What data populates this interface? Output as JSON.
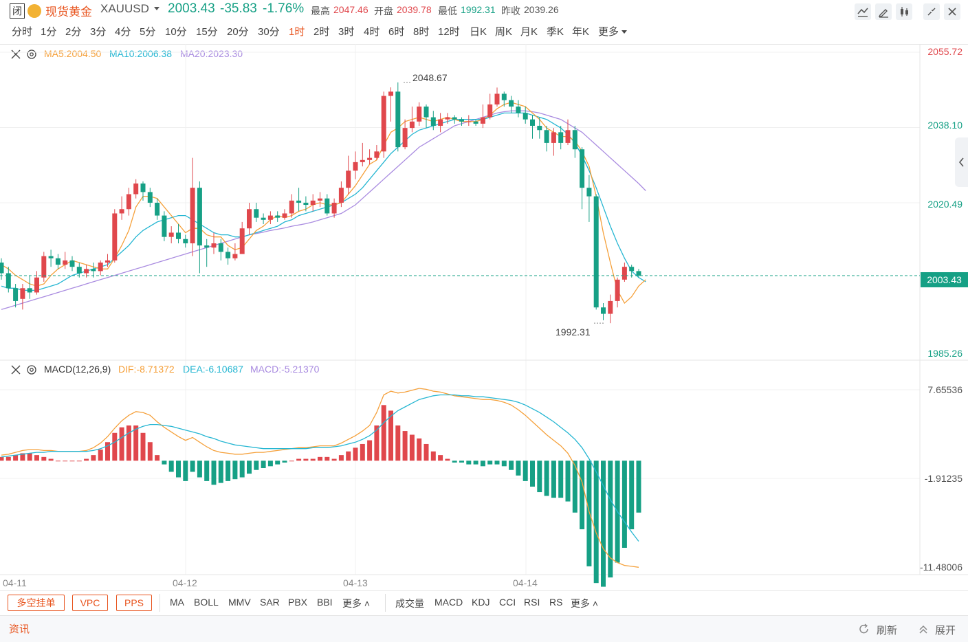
{
  "header": {
    "status_badge": "闭",
    "symbol_name": "现货黄金",
    "symbol_code": "XAUUSD",
    "price": "2003.43",
    "change": "-35.83",
    "change_pct": "-1.76%",
    "high_label": "最高",
    "high_value": "2047.46",
    "open_label": "开盘",
    "open_value": "2039.78",
    "low_label": "最低",
    "low_value": "1992.31",
    "prev_close_label": "昨收",
    "prev_close_value": "2039.26"
  },
  "periods": [
    "分时",
    "1分",
    "2分",
    "3分",
    "4分",
    "5分",
    "10分",
    "15分",
    "20分",
    "30分",
    "1时",
    "2时",
    "3时",
    "4时",
    "6时",
    "8时",
    "12时",
    "日K",
    "周K",
    "月K",
    "季K",
    "年K",
    "更多"
  ],
  "active_period": "1时",
  "main_legend": {
    "ma5": "MA5:2004.50",
    "ma10": "MA10:2006.38",
    "ma20": "MA20:2023.30"
  },
  "macd_legend": {
    "name": "MACD(12,26,9)",
    "dif": "DIF:-8.71372",
    "dea": "DEA:-6.10687",
    "macd": "MACD:-5.21370"
  },
  "price_axis": [
    "2055.72",
    "2038.10",
    "2020.49",
    "2003.43",
    "1985.26"
  ],
  "macd_axis": [
    "7.65536",
    "-1.91235",
    "-11.48006"
  ],
  "x_axis": [
    "04-11",
    "04-12",
    "04-13",
    "04-14"
  ],
  "annotations": {
    "high": "2048.67",
    "low": "1992.31"
  },
  "current_price_tag": "2003.43",
  "indicator_buttons": [
    "多空挂单",
    "VPC",
    "PPS"
  ],
  "main_indicators": [
    "MA",
    "BOLL",
    "MMV",
    "SAR",
    "PBX",
    "BBI",
    "更多"
  ],
  "sub_indicators": [
    "成交量",
    "MACD",
    "KDJ",
    "CCI",
    "RSI",
    "RS",
    "更多"
  ],
  "footer": {
    "news": "资讯",
    "refresh": "刷新",
    "expand": "展开"
  },
  "colors": {
    "up": "#e0474c",
    "down": "#16a085",
    "ma5": "#f5a03a",
    "ma10": "#25b6d2",
    "ma20": "#a98be0",
    "accent": "#e8541e"
  },
  "chart_data": {
    "type": "candlestick",
    "y_range": [
      1985.26,
      2055.72
    ],
    "macd_range": [
      -11.48006,
      7.65536
    ],
    "candles": [
      [
        2006.5,
        2004.0,
        2007.5,
        2002.5
      ],
      [
        2004.0,
        2000.5,
        2005.5,
        1999.5
      ],
      [
        2000.5,
        1997.5,
        2001.5,
        1996.0
      ],
      [
        1998.0,
        2000.5,
        2001.5,
        1995.5
      ],
      [
        2000.5,
        1999.5,
        2003.5,
        1998.0
      ],
      [
        1999.5,
        2003.0,
        2004.5,
        1999.0
      ],
      [
        2003.0,
        2008.0,
        2009.0,
        2002.0
      ],
      [
        2008.0,
        2007.5,
        2009.5,
        2005.5
      ],
      [
        2007.5,
        2006.0,
        2008.5,
        2005.0
      ],
      [
        2006.0,
        2007.0,
        2009.0,
        2005.0
      ],
      [
        2007.0,
        2005.5,
        2008.0,
        2004.5
      ],
      [
        2005.5,
        2004.0,
        2006.5,
        2003.0
      ],
      [
        2004.0,
        2005.0,
        2006.0,
        2003.0
      ],
      [
        2005.0,
        2004.5,
        2006.5,
        2003.0
      ],
      [
        2004.5,
        2006.5,
        2007.0,
        2003.5
      ],
      [
        2006.5,
        2007.0,
        2008.5,
        2005.5
      ],
      [
        2007.0,
        2018.0,
        2019.0,
        2006.5
      ],
      [
        2018.0,
        2019.0,
        2022.0,
        2016.5
      ],
      [
        2019.0,
        2022.5,
        2024.0,
        2017.5
      ],
      [
        2022.5,
        2025.0,
        2026.0,
        2021.5
      ],
      [
        2025.0,
        2023.0,
        2025.5,
        2021.0
      ],
      [
        2023.0,
        2020.5,
        2024.0,
        2019.5
      ],
      [
        2020.5,
        2017.5,
        2021.5,
        2016.5
      ],
      [
        2017.5,
        2012.5,
        2018.5,
        2011.5
      ],
      [
        2012.5,
        2013.5,
        2015.0,
        2011.0
      ],
      [
        2013.5,
        2012.0,
        2015.5,
        2011.0
      ],
      [
        2012.0,
        2011.0,
        2013.0,
        2010.0
      ],
      [
        2011.0,
        2024.0,
        2031.0,
        2008.0
      ],
      [
        2024.0,
        2010.5,
        2025.5,
        2004.0
      ],
      [
        2010.5,
        2010.0,
        2012.0,
        2005.5
      ],
      [
        2010.0,
        2011.0,
        2013.5,
        2008.5
      ],
      [
        2011.0,
        2009.0,
        2012.0,
        2007.0
      ],
      [
        2009.0,
        2007.5,
        2010.0,
        2006.0
      ],
      [
        2007.5,
        2008.5,
        2011.0,
        2007.0
      ],
      [
        2008.5,
        2014.5,
        2016.0,
        2008.5
      ],
      [
        2014.5,
        2019.0,
        2020.5,
        2013.0
      ],
      [
        2019.0,
        2017.0,
        2020.5,
        2016.0
      ],
      [
        2017.0,
        2016.5,
        2018.0,
        2015.5
      ],
      [
        2016.5,
        2017.5,
        2018.5,
        2015.5
      ],
      [
        2017.5,
        2017.0,
        2018.5,
        2016.0
      ],
      [
        2017.0,
        2018.0,
        2019.0,
        2016.5
      ],
      [
        2018.0,
        2021.0,
        2022.5,
        2017.0
      ],
      [
        2021.0,
        2020.5,
        2024.0,
        2018.5
      ],
      [
        2020.5,
        2020.0,
        2022.0,
        2018.5
      ],
      [
        2020.0,
        2021.0,
        2022.5,
        2018.5
      ],
      [
        2021.0,
        2021.5,
        2023.0,
        2019.5
      ],
      [
        2021.5,
        2018.0,
        2022.5,
        2017.5
      ],
      [
        2018.0,
        2020.5,
        2021.5,
        2017.0
      ],
      [
        2020.5,
        2024.0,
        2025.5,
        2019.5
      ],
      [
        2024.0,
        2028.0,
        2031.5,
        2022.5
      ],
      [
        2028.0,
        2030.0,
        2032.5,
        2026.0
      ],
      [
        2030.0,
        2030.5,
        2034.5,
        2029.0
      ],
      [
        2030.5,
        2031.0,
        2033.0,
        2029.5
      ],
      [
        2031.0,
        2032.5,
        2034.0,
        2030.5
      ],
      [
        2032.5,
        2045.5,
        2046.5,
        2031.0
      ],
      [
        2045.5,
        2046.5,
        2047.5,
        2039.5
      ],
      [
        2046.5,
        2033.5,
        2048.67,
        2032.5
      ],
      [
        2033.5,
        2038.0,
        2040.0,
        2033.0
      ],
      [
        2038.0,
        2039.5,
        2043.0,
        2037.0
      ],
      [
        2039.5,
        2043.0,
        2044.0,
        2038.5
      ],
      [
        2043.0,
        2040.5,
        2043.5,
        2038.0
      ],
      [
        2040.5,
        2038.5,
        2042.0,
        2037.5
      ],
      [
        2038.5,
        2040.0,
        2041.5,
        2037.0
      ],
      [
        2040.0,
        2040.5,
        2041.5,
        2039.0
      ],
      [
        2040.5,
        2040.0,
        2041.0,
        2039.0
      ],
      [
        2040.0,
        2039.5,
        2040.5,
        2038.5
      ],
      [
        2039.5,
        2039.5,
        2041.0,
        2038.5
      ],
      [
        2039.5,
        2039.0,
        2040.0,
        2038.5
      ],
      [
        2039.0,
        2040.5,
        2043.5,
        2038.0
      ],
      [
        2040.5,
        2043.5,
        2046.0,
        2040.0
      ],
      [
        2043.5,
        2046.0,
        2047.46,
        2043.0
      ],
      [
        2046.0,
        2044.5,
        2046.5,
        2043.0
      ],
      [
        2044.5,
        2043.0,
        2045.5,
        2041.5
      ],
      [
        2043.0,
        2041.5,
        2044.5,
        2040.5
      ],
      [
        2041.5,
        2040.0,
        2043.0,
        2039.0
      ],
      [
        2040.0,
        2038.5,
        2041.0,
        2035.5
      ],
      [
        2038.5,
        2037.5,
        2040.5,
        2035.5
      ],
      [
        2037.5,
        2034.5,
        2038.5,
        2032.5
      ],
      [
        2034.5,
        2037.0,
        2038.0,
        2031.5
      ],
      [
        2037.0,
        2034.5,
        2038.5,
        2033.0
      ],
      [
        2034.5,
        2037.5,
        2040.0,
        2034.0
      ],
      [
        2037.5,
        2033.0,
        2038.5,
        2031.0
      ],
      [
        2033.0,
        2024.0,
        2033.5,
        2019.0
      ],
      [
        2024.0,
        2022.0,
        2027.0,
        2016.0
      ],
      [
        2022.0,
        1996.0,
        2022.5,
        1995.5
      ],
      [
        1996.0,
        1994.5,
        1997.0,
        1993.0
      ],
      [
        1994.5,
        1997.5,
        1999.0,
        1992.31
      ],
      [
        1997.5,
        2002.5,
        2003.0,
        1996.0
      ],
      [
        2002.5,
        2005.5,
        2006.5,
        2002.0
      ],
      [
        2005.5,
        2004.5,
        2006.0,
        2003.0
      ],
      [
        2004.5,
        2003.43,
        2005.0,
        2003.0
      ]
    ],
    "ma5": [
      2006.0,
      2005.0,
      2003.5,
      2002.5,
      2001.5,
      2001.0,
      2001.5,
      2003.5,
      2005.0,
      2006.0,
      2007.0,
      2006.5,
      2006.0,
      2005.5,
      2005.0,
      2005.0,
      2007.5,
      2010.5,
      2014.0,
      2019.5,
      2022.0,
      2022.0,
      2021.5,
      2019.5,
      2017.5,
      2015.5,
      2013.5,
      2014.5,
      2014.5,
      2013.0,
      2012.5,
      2012.5,
      2010.5,
      2009.5,
      2010.0,
      2012.0,
      2014.0,
      2015.0,
      2016.5,
      2017.5,
      2017.0,
      2017.5,
      2018.5,
      2019.0,
      2020.0,
      2020.5,
      2020.0,
      2020.0,
      2020.5,
      2022.5,
      2024.5,
      2027.0,
      2029.5,
      2030.5,
      2034.0,
      2037.0,
      2038.0,
      2039.5,
      2040.0,
      2040.5,
      2040.0,
      2039.5,
      2040.0,
      2040.5,
      2040.0,
      2039.5,
      2039.5,
      2039.5,
      2040.0,
      2041.0,
      2042.5,
      2043.5,
      2044.0,
      2043.5,
      2043.0,
      2041.5,
      2040.0,
      2038.0,
      2037.0,
      2036.0,
      2036.0,
      2035.0,
      2032.5,
      2029.0,
      2022.0,
      2013.5,
      2006.5,
      2000.0,
      1997.0,
      1998.5,
      2001.0,
      2002.5
    ],
    "ma10": [
      2001.0,
      2000.5,
      2000.5,
      2000.0,
      2000.0,
      2000.0,
      2000.5,
      2001.0,
      2001.5,
      2002.5,
      2003.5,
      2004.0,
      2004.5,
      2005.0,
      2005.5,
      2006.0,
      2007.5,
      2009.0,
      2010.5,
      2012.5,
      2014.0,
      2015.0,
      2016.0,
      2016.5,
      2017.0,
      2017.5,
      2017.5,
      2016.5,
      2015.5,
      2014.5,
      2013.5,
      2013.0,
      2013.0,
      2012.5,
      2012.5,
      2013.0,
      2013.5,
      2014.0,
      2014.5,
      2015.0,
      2016.0,
      2016.5,
      2017.5,
      2018.0,
      2018.5,
      2019.0,
      2019.5,
      2020.0,
      2020.5,
      2021.5,
      2022.5,
      2024.0,
      2026.0,
      2028.0,
      2030.0,
      2032.0,
      2033.5,
      2035.0,
      2036.5,
      2037.5,
      2038.0,
      2038.5,
      2039.0,
      2039.5,
      2040.0,
      2040.0,
      2040.0,
      2040.0,
      2040.0,
      2040.5,
      2041.0,
      2041.5,
      2041.5,
      2041.5,
      2041.5,
      2041.0,
      2040.5,
      2040.0,
      2039.0,
      2038.0,
      2036.5,
      2034.5,
      2031.5,
      2028.0,
      2024.0,
      2019.5,
      2015.0,
      2011.0,
      2007.5,
      2004.5,
      2003.0,
      2002.0
    ],
    "ma20": [
      1995.5,
      1996.0,
      1996.5,
      1997.0,
      1997.5,
      1998.0,
      1998.5,
      1999.0,
      1999.5,
      2000.0,
      2000.5,
      2001.0,
      2001.5,
      2002.0,
      2002.5,
      2003.0,
      2003.5,
      2004.0,
      2004.5,
      2005.0,
      2005.5,
      2006.0,
      2006.5,
      2007.0,
      2007.5,
      2008.0,
      2008.5,
      2009.0,
      2009.5,
      2010.0,
      2010.5,
      2011.0,
      2011.5,
      2012.0,
      2012.5,
      2013.0,
      2013.3,
      2013.6,
      2014.0,
      2014.3,
      2014.6,
      2015.0,
      2015.3,
      2015.6,
      2016.0,
      2016.5,
      2017.0,
      2017.5,
      2018.0,
      2019.0,
      2020.0,
      2021.5,
      2023.0,
      2024.5,
      2026.0,
      2027.5,
      2029.0,
      2030.5,
      2032.0,
      2033.5,
      2034.5,
      2035.5,
      2036.5,
      2037.5,
      2038.5,
      2039.0,
      2039.5,
      2040.0,
      2040.5,
      2041.0,
      2041.5,
      2041.8,
      2042.0,
      2042.0,
      2042.0,
      2041.8,
      2041.5,
      2041.0,
      2040.5,
      2040.0,
      2039.0,
      2038.0,
      2037.0,
      2035.5,
      2034.0,
      2032.5,
      2031.0,
      2029.5,
      2028.0,
      2026.5,
      2025.0,
      2023.3
    ],
    "dif": [
      0.6,
      0.7,
      0.9,
      1.1,
      1.2,
      1.2,
      1.1,
      1.1,
      1.0,
      1.0,
      1.0,
      1.0,
      1.1,
      1.4,
      1.9,
      2.6,
      3.5,
      4.3,
      4.9,
      5.3,
      5.2,
      4.9,
      4.2,
      3.6,
      3.1,
      2.6,
      2.2,
      2.5,
      2.0,
      1.5,
      1.1,
      0.9,
      0.8,
      0.7,
      0.7,
      0.8,
      0.9,
      0.9,
      1.0,
      1.1,
      1.2,
      1.3,
      1.4,
      1.4,
      1.5,
      1.6,
      1.6,
      1.6,
      1.9,
      2.3,
      2.7,
      3.2,
      3.8,
      5.2,
      7.1,
      7.5,
      7.3,
      7.4,
      7.6,
      7.8,
      7.7,
      7.5,
      7.4,
      7.2,
      7.0,
      6.9,
      6.8,
      6.7,
      6.6,
      6.6,
      6.5,
      6.3,
      6.0,
      5.5,
      4.9,
      4.2,
      3.5,
      2.8,
      2.2,
      1.6,
      0.8,
      -0.5,
      -2.3,
      -5.5,
      -7.8,
      -9.5,
      -10.5,
      -11.0,
      -11.3,
      -11.4,
      -11.5
    ],
    "dea": [
      0.4,
      0.5,
      0.6,
      0.7,
      0.8,
      0.9,
      0.9,
      1.0,
      1.0,
      1.0,
      1.0,
      1.0,
      1.0,
      1.1,
      1.3,
      1.6,
      2.0,
      2.5,
      3.0,
      3.4,
      3.7,
      3.9,
      3.9,
      3.8,
      3.7,
      3.5,
      3.3,
      3.1,
      2.9,
      2.6,
      2.4,
      2.1,
      1.9,
      1.7,
      1.6,
      1.5,
      1.4,
      1.3,
      1.3,
      1.3,
      1.3,
      1.3,
      1.3,
      1.3,
      1.4,
      1.4,
      1.4,
      1.5,
      1.6,
      1.8,
      2.0,
      2.3,
      2.7,
      3.3,
      4.1,
      4.8,
      5.4,
      5.8,
      6.2,
      6.6,
      6.8,
      7.0,
      7.1,
      7.1,
      7.1,
      7.0,
      7.0,
      6.9,
      6.9,
      6.8,
      6.7,
      6.6,
      6.5,
      6.3,
      6.0,
      5.6,
      5.2,
      4.7,
      4.2,
      3.6,
      3.0,
      2.3,
      1.4,
      0.2,
      -1.2,
      -2.7,
      -4.2,
      -5.5,
      -6.6,
      -7.7,
      -8.7
    ]
  }
}
